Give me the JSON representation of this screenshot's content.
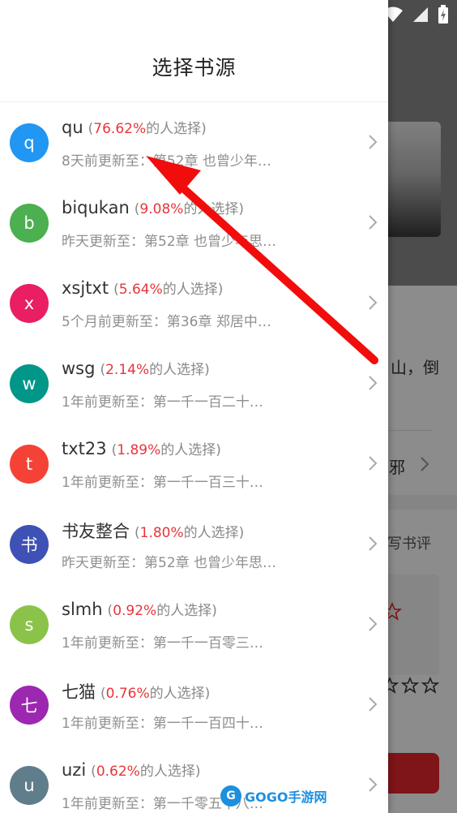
{
  "drawer": {
    "title": "选择书源"
  },
  "sources": [
    {
      "letter": "q",
      "name": "qu",
      "pct": "76.62%",
      "suffix": "的人选择)",
      "update": "8天前更新至：第52章 也曾少年…",
      "color": "#2196F3"
    },
    {
      "letter": "b",
      "name": "biqukan",
      "pct": "9.08%",
      "suffix": "的人选择)",
      "update": "昨天更新至：第52章 也曾少年思…",
      "color": "#4CAF50"
    },
    {
      "letter": "x",
      "name": "xsjtxt",
      "pct": "5.64%",
      "suffix": "的人选择)",
      "update": "5个月前更新至：第36章 郑居中…",
      "color": "#E91E63"
    },
    {
      "letter": "w",
      "name": "wsg",
      "pct": "2.14%",
      "suffix": "的人选择)",
      "update": "1年前更新至：第一千一百二十…",
      "color": "#009688"
    },
    {
      "letter": "t",
      "name": "txt23",
      "pct": "1.89%",
      "suffix": "的人选择)",
      "update": "1年前更新至：第一千一百三十…",
      "color": "#F44336"
    },
    {
      "letter": "书",
      "name": "书友整合",
      "pct": "1.80%",
      "suffix": "的人选择)",
      "update": "昨天更新至：第52章 也曾少年思…",
      "color": "#3F51B5"
    },
    {
      "letter": "s",
      "name": "slmh",
      "pct": "0.92%",
      "suffix": "的人选择)",
      "update": "1年前更新至：第一千一百零三…",
      "color": "#8BC34A"
    },
    {
      "letter": "七",
      "name": "七猫",
      "pct": "0.76%",
      "suffix": "的人选择)",
      "update": "1年前更新至：第一千一百四十…",
      "color": "#9C27B0"
    },
    {
      "letter": "u",
      "name": "uzi",
      "pct": "0.62%",
      "suffix": "的人选择)",
      "update": "1年前更新至：第一千零五十八…",
      "color": "#607D8B"
    }
  ],
  "open_paren": "(",
  "background": {
    "text_mountain": "山，倒",
    "text_evil": "邪",
    "text_review": "写书评"
  },
  "watermark": {
    "logo": "G",
    "text": "GOGO手游网"
  }
}
